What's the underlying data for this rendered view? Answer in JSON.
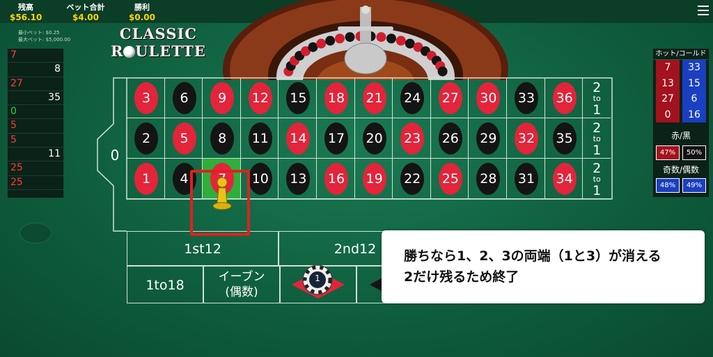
{
  "header": {
    "balance_label": "残高",
    "balance_value": "$56.10",
    "bet_label": "ベット合計",
    "bet_value": "$4.00",
    "win_label": "勝利",
    "win_value": "$0.00"
  },
  "limits": {
    "min": "最小ベット: $0.25",
    "max": "最大ベット: $5,000.00"
  },
  "logo": {
    "line1": "CLASSIC",
    "line2": "R  ULETTE"
  },
  "history": [
    {
      "n": "7",
      "color": "red"
    },
    {
      "n": "8",
      "color": "black"
    },
    {
      "n": "27",
      "color": "red"
    },
    {
      "n": "35",
      "color": "black"
    },
    {
      "n": "0",
      "color": "green"
    },
    {
      "n": "5",
      "color": "red"
    },
    {
      "n": "5",
      "color": "red"
    },
    {
      "n": "11",
      "color": "black"
    },
    {
      "n": "25",
      "color": "red"
    },
    {
      "n": "25",
      "color": "red"
    }
  ],
  "hotcold": {
    "title": "ホット/コールド",
    "hot": [
      "7",
      "13",
      "27",
      "0"
    ],
    "cold": [
      "33",
      "15",
      "6",
      "16"
    ],
    "red_black_label": "赤/黒",
    "red_pct": "47%",
    "black_pct": "50%",
    "odd_even_label": "奇数/偶数",
    "odd_pct": "48%",
    "even_pct": "49%"
  },
  "board": {
    "zero": "0",
    "rows": [
      [
        [
          "3",
          "r"
        ],
        [
          "6",
          "b"
        ],
        [
          "9",
          "r"
        ],
        [
          "12",
          "r"
        ],
        [
          "15",
          "b"
        ],
        [
          "18",
          "r"
        ],
        [
          "21",
          "r"
        ],
        [
          "24",
          "b"
        ],
        [
          "27",
          "r"
        ],
        [
          "30",
          "r"
        ],
        [
          "33",
          "b"
        ],
        [
          "36",
          "r"
        ]
      ],
      [
        [
          "2",
          "b"
        ],
        [
          "5",
          "r"
        ],
        [
          "8",
          "b"
        ],
        [
          "11",
          "b"
        ],
        [
          "14",
          "r"
        ],
        [
          "17",
          "b"
        ],
        [
          "20",
          "b"
        ],
        [
          "23",
          "r"
        ],
        [
          "26",
          "b"
        ],
        [
          "29",
          "b"
        ],
        [
          "32",
          "r"
        ],
        [
          "35",
          "b"
        ]
      ],
      [
        [
          "1",
          "r"
        ],
        [
          "4",
          "b"
        ],
        [
          "7",
          "r"
        ],
        [
          "10",
          "b"
        ],
        [
          "13",
          "b"
        ],
        [
          "16",
          "r"
        ],
        [
          "19",
          "r"
        ],
        [
          "22",
          "b"
        ],
        [
          "25",
          "r"
        ],
        [
          "28",
          "b"
        ],
        [
          "31",
          "b"
        ],
        [
          "34",
          "r"
        ]
      ]
    ],
    "col_label_top": "2",
    "col_label_mid": "to",
    "col_label_bot": "1",
    "dozen1": "1st12",
    "dozen2": "2nd12",
    "low": "1to18",
    "even_line1": "イーブン",
    "even_line2": "(偶数)",
    "chip_value": "1"
  },
  "note": {
    "line1": "勝ちなら1、2、3の両端（1と3）が消える",
    "line2": "2だけ残るため終了"
  },
  "colors": {
    "red": "#e3243a",
    "black": "#141414",
    "green": "#35b54a",
    "felt": "#1a7a52"
  }
}
